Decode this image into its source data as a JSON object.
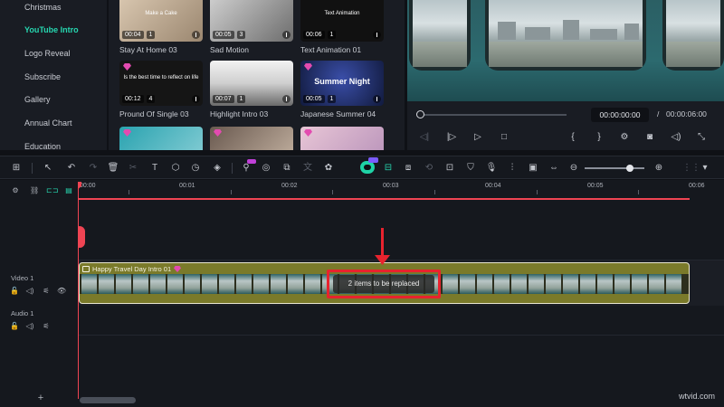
{
  "sidebar": {
    "items": [
      {
        "label": "Christmas",
        "active": false
      },
      {
        "label": "YouTube Intro",
        "active": true
      },
      {
        "label": "Logo Reveal",
        "active": false
      },
      {
        "label": "Subscribe",
        "active": false
      },
      {
        "label": "Gallery",
        "active": false
      },
      {
        "label": "Annual Chart",
        "active": false
      },
      {
        "label": "Education",
        "active": false
      }
    ]
  },
  "library": {
    "cards": [
      {
        "title": "Stay At Home 03",
        "duration": "00:04",
        "scenes": "1",
        "overlay": "Make a Cake",
        "premium": false
      },
      {
        "title": "Sad Motion",
        "duration": "00:05",
        "scenes": "3",
        "overlay": "",
        "premium": false
      },
      {
        "title": "Text Animation 01",
        "duration": "00:06",
        "scenes": "1",
        "overlay": "Text Animation",
        "premium": false
      },
      {
        "title": "Pround Of Single 03",
        "duration": "00:12",
        "scenes": "4",
        "overlay": "Is the best time to reflect on life",
        "premium": true
      },
      {
        "title": "Highlight Intro 03",
        "duration": "00:07",
        "scenes": "1",
        "overlay": "",
        "premium": false
      },
      {
        "title": "Japanese Summer 04",
        "duration": "00:05",
        "scenes": "1",
        "overlay": "Summer Night",
        "premium": true
      }
    ]
  },
  "preview": {
    "time_current": "00:00:00:00",
    "time_separator": "/",
    "time_total": "00:00:06:00",
    "progress": 0.0
  },
  "toolbar": {
    "new_badge": "NEW",
    "ai_badge": "AI"
  },
  "timeline": {
    "ruler_ticks": [
      "00:00",
      "00:01",
      "00:02",
      "00:03",
      "00:04",
      "00:05",
      "00:06"
    ],
    "tracks": {
      "video": "Video 1",
      "audio": "Audio 1"
    },
    "clip": {
      "title": "Happy Travel Day Intro 01",
      "replace_label": "2 items to be replaced"
    }
  },
  "watermark": "wtvid.com",
  "colors": {
    "accent": "#26d7b0",
    "playhead": "#ef4453",
    "annotation": "#e8232e",
    "clip": "#7a7a2a"
  }
}
